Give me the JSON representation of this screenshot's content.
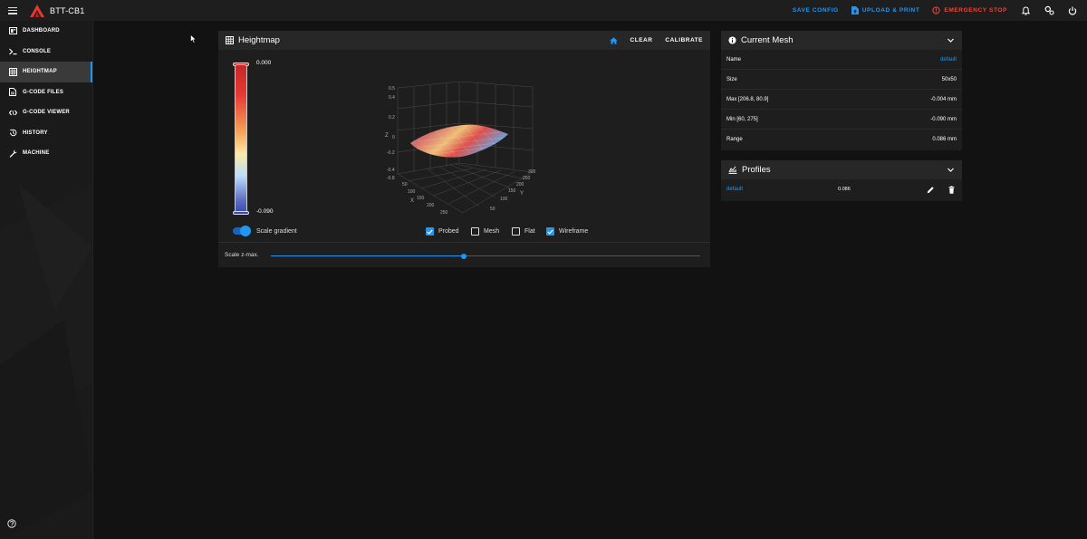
{
  "app": {
    "title": "BTT-CB1",
    "brand_color": "#e53935"
  },
  "topbar": {
    "save_config": "SAVE CONFIG",
    "upload_print": "UPLOAD & PRINT",
    "emergency_stop": "EMERGENCY STOP",
    "icons": [
      "bell-icon",
      "cogs-icon",
      "power-icon"
    ]
  },
  "sidebar": {
    "items": [
      {
        "label": "DASHBOARD",
        "icon": "dashboard-icon"
      },
      {
        "label": "CONSOLE",
        "icon": "console-icon"
      },
      {
        "label": "HEIGHTMAP",
        "icon": "grid-icon",
        "active": true
      },
      {
        "label": "G-CODE FILES",
        "icon": "file-icon"
      },
      {
        "label": "G-CODE VIEWER",
        "icon": "code-icon"
      },
      {
        "label": "HISTORY",
        "icon": "history-icon"
      },
      {
        "label": "MACHINE",
        "icon": "wrench-icon"
      }
    ]
  },
  "heightmap": {
    "title": "Heightmap",
    "clear": "CLEAR",
    "calibrate": "CALIBRATE",
    "gradient_max": "0.000",
    "gradient_min": "-0.090",
    "scale_gradient": "Scale gradient",
    "probed": "Probed",
    "mesh": "Mesh",
    "flat": "Flat",
    "wireframe": "Wireframe",
    "options": {
      "scale_gradient": true,
      "probed": true,
      "mesh": false,
      "flat": false,
      "wireframe": true
    },
    "scale_zmax_label": "Scale z-max.",
    "scale_zmax_value": 0.45,
    "plot": {
      "z_axis": "Z",
      "x_axis": "X",
      "y_axis": "Y",
      "z_ticks": [
        "0.5",
        "0.4",
        "0.2",
        "0",
        "-0.2",
        "-0.4",
        "-0.8"
      ],
      "x_ticks": [
        "50",
        "100",
        "150",
        "200",
        "250"
      ],
      "y_ticks": [
        "300",
        "250",
        "200",
        "150",
        "100",
        "50"
      ]
    }
  },
  "current_mesh": {
    "title": "Current Mesh",
    "rows": [
      {
        "label": "Name",
        "value": "default"
      },
      {
        "label": "Size",
        "value": "50x50"
      },
      {
        "label": "Max [206.8, 80.9]",
        "value": "-0.004 mm"
      },
      {
        "label": "Min [60, 275]",
        "value": "-0.090 mm"
      },
      {
        "label": "Range",
        "value": "0.086 mm"
      }
    ]
  },
  "profiles": {
    "title": "Profiles",
    "items": [
      {
        "name": "default",
        "value": "0.086"
      }
    ]
  }
}
